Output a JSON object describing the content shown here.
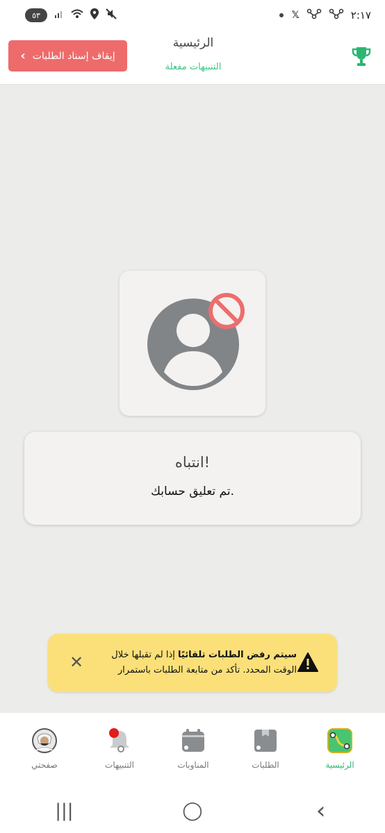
{
  "status_bar": {
    "battery": "٥٣",
    "time": "٢:١٧",
    "icons": [
      "signal-icon",
      "wifi-icon",
      "location-icon",
      "mute-icon",
      "app-notification-icon",
      "x-app-icon",
      "dot-icon"
    ]
  },
  "header": {
    "title": "الرئيسية",
    "subtitle": "التنبيهات مفعلة",
    "stop_button_label": "إيقاف إسناد الطلبات",
    "trophy_icon": "trophy-icon"
  },
  "colors": {
    "primary_green": "#3cc48a",
    "stop_red": "#ee6b6b",
    "warning_yellow": "#fbe07a",
    "background": "#ececeb"
  },
  "alert": {
    "title": "انتباه!",
    "message": "تم تعليق حسابك."
  },
  "warning": {
    "bold_text": "سيتم رفض الطلبات تلقائيًا",
    "text": " إذا لم تقبلها خلال الوقت المحدد. تأكد من متابعة الطلبات باستمرار"
  },
  "bottom_nav": {
    "items": [
      {
        "label": "الرئيسية",
        "icon": "home-route-icon",
        "active": true
      },
      {
        "label": "الطلبات",
        "icon": "orders-icon",
        "active": false
      },
      {
        "label": "المناوبات",
        "icon": "shifts-calendar-icon",
        "active": false
      },
      {
        "label": "التنبيهات",
        "icon": "notifications-bell-icon",
        "active": false
      },
      {
        "label": "صفحتي",
        "icon": "profile-avatar-icon",
        "active": false
      }
    ]
  },
  "system_nav": {
    "recents": "|||",
    "home": "◯",
    "back": "‹"
  }
}
